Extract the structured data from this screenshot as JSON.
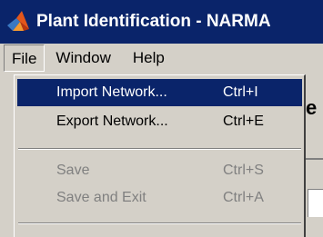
{
  "window": {
    "title": "Plant Identification - NARMA"
  },
  "menubar": {
    "items": [
      {
        "label": "File"
      },
      {
        "label": "Window"
      },
      {
        "label": "Help"
      }
    ]
  },
  "file_menu": {
    "items": [
      {
        "label": "Import Network...",
        "shortcut": "Ctrl+I",
        "state": "selected"
      },
      {
        "label": "Export Network...",
        "shortcut": "Ctrl+E",
        "state": "enabled"
      },
      {
        "label": "Save",
        "shortcut": "Ctrl+S",
        "state": "disabled"
      },
      {
        "label": "Save and Exit",
        "shortcut": "Ctrl+A",
        "state": "disabled"
      }
    ]
  },
  "background": {
    "heading_fragment": "e"
  },
  "colors": {
    "titlebar": "#0a246a",
    "face": "#d4d0c8",
    "selection": "#0a246a",
    "disabled_text": "#808080"
  },
  "icons": {
    "app_icon": "matlab-logo-icon"
  }
}
